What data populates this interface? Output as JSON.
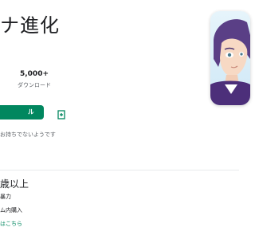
{
  "app": {
    "title": "ナ進化",
    "downloads_value": "5,000+",
    "downloads_caption": "ダウンロード"
  },
  "actions": {
    "install_label": "ル"
  },
  "icons": {
    "share": "share-icon",
    "wishlist": "wishlist-icon"
  },
  "device_note": "お持ちでないようです",
  "content_rating": {
    "title": "歳以上",
    "details": [
      "暴力",
      "ム内購入"
    ],
    "link_text": "はこちら"
  },
  "colors": {
    "accent": "#01875f",
    "text": "#202124",
    "secondary_text": "#5f6368"
  }
}
